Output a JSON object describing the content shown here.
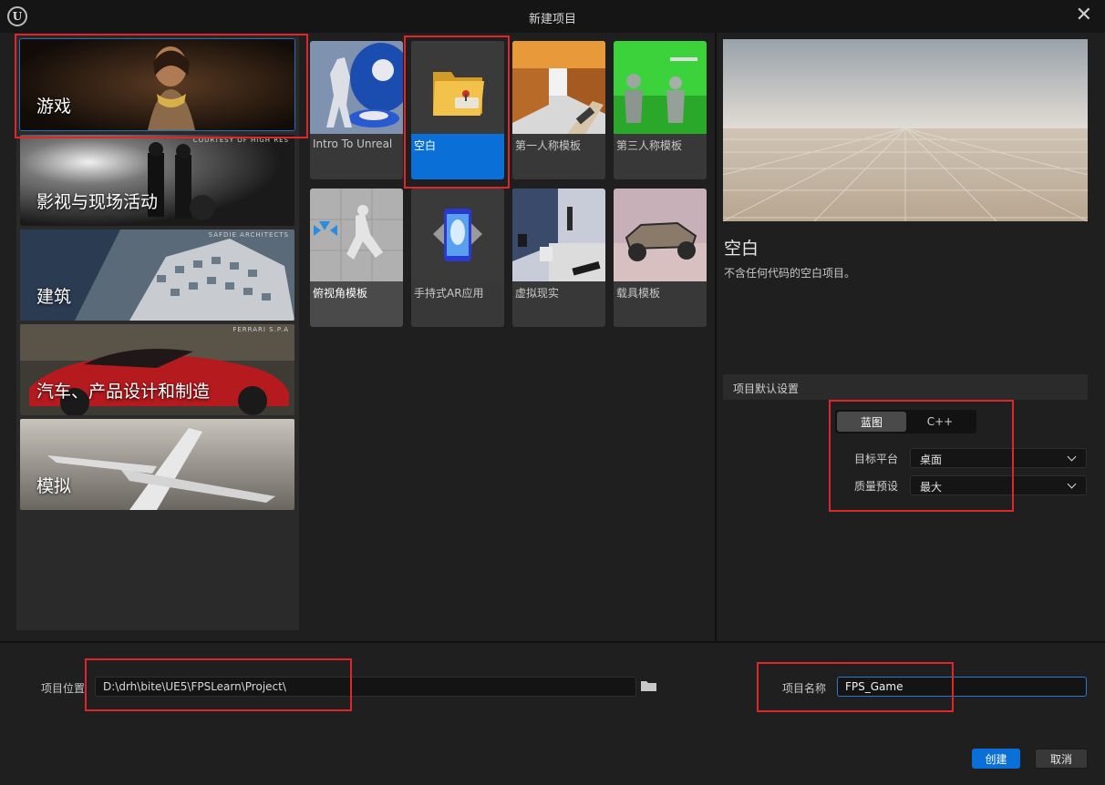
{
  "window": {
    "title": "新建项目",
    "logo": "U"
  },
  "categories": [
    {
      "label": "游戏",
      "credit": ""
    },
    {
      "label": "影视与现场活动",
      "credit": "COURTESY OF HIGH RES"
    },
    {
      "label": "建筑",
      "credit": "SAFDIE ARCHITECTS"
    },
    {
      "label": "汽车、产品设计和制造",
      "credit": "FERRARI S.P.A"
    },
    {
      "label": "模拟",
      "credit": ""
    }
  ],
  "selected_category": "游戏",
  "templates": [
    {
      "label": "Intro To Unreal"
    },
    {
      "label": "空白"
    },
    {
      "label": "第一人称模板"
    },
    {
      "label": "第三人称模板"
    },
    {
      "label": "俯视角模板"
    },
    {
      "label": "手持式AR应用"
    },
    {
      "label": "虚拟现实"
    },
    {
      "label": "载具模板"
    }
  ],
  "selected_template": "空白",
  "preview": {
    "title": "空白",
    "description": "不含任何代码的空白项目。"
  },
  "settings": {
    "header": "项目默认设置",
    "mode_options": [
      "蓝图",
      "C++"
    ],
    "selected_mode": "蓝图",
    "target_platform_label": "目标平台",
    "target_platform_value": "桌面",
    "quality_label": "质量预设",
    "quality_value": "最大"
  },
  "bottom": {
    "location_label": "项目位置",
    "location_value": "D:\\drh\\bite\\UE5\\FPSLearn\\Project\\",
    "name_label": "项目名称",
    "name_value": "FPS_Game",
    "create_label": "创建",
    "cancel_label": "取消"
  },
  "colors": {
    "accent": "#0a6fd6",
    "highlight_box": "#e0262b"
  }
}
